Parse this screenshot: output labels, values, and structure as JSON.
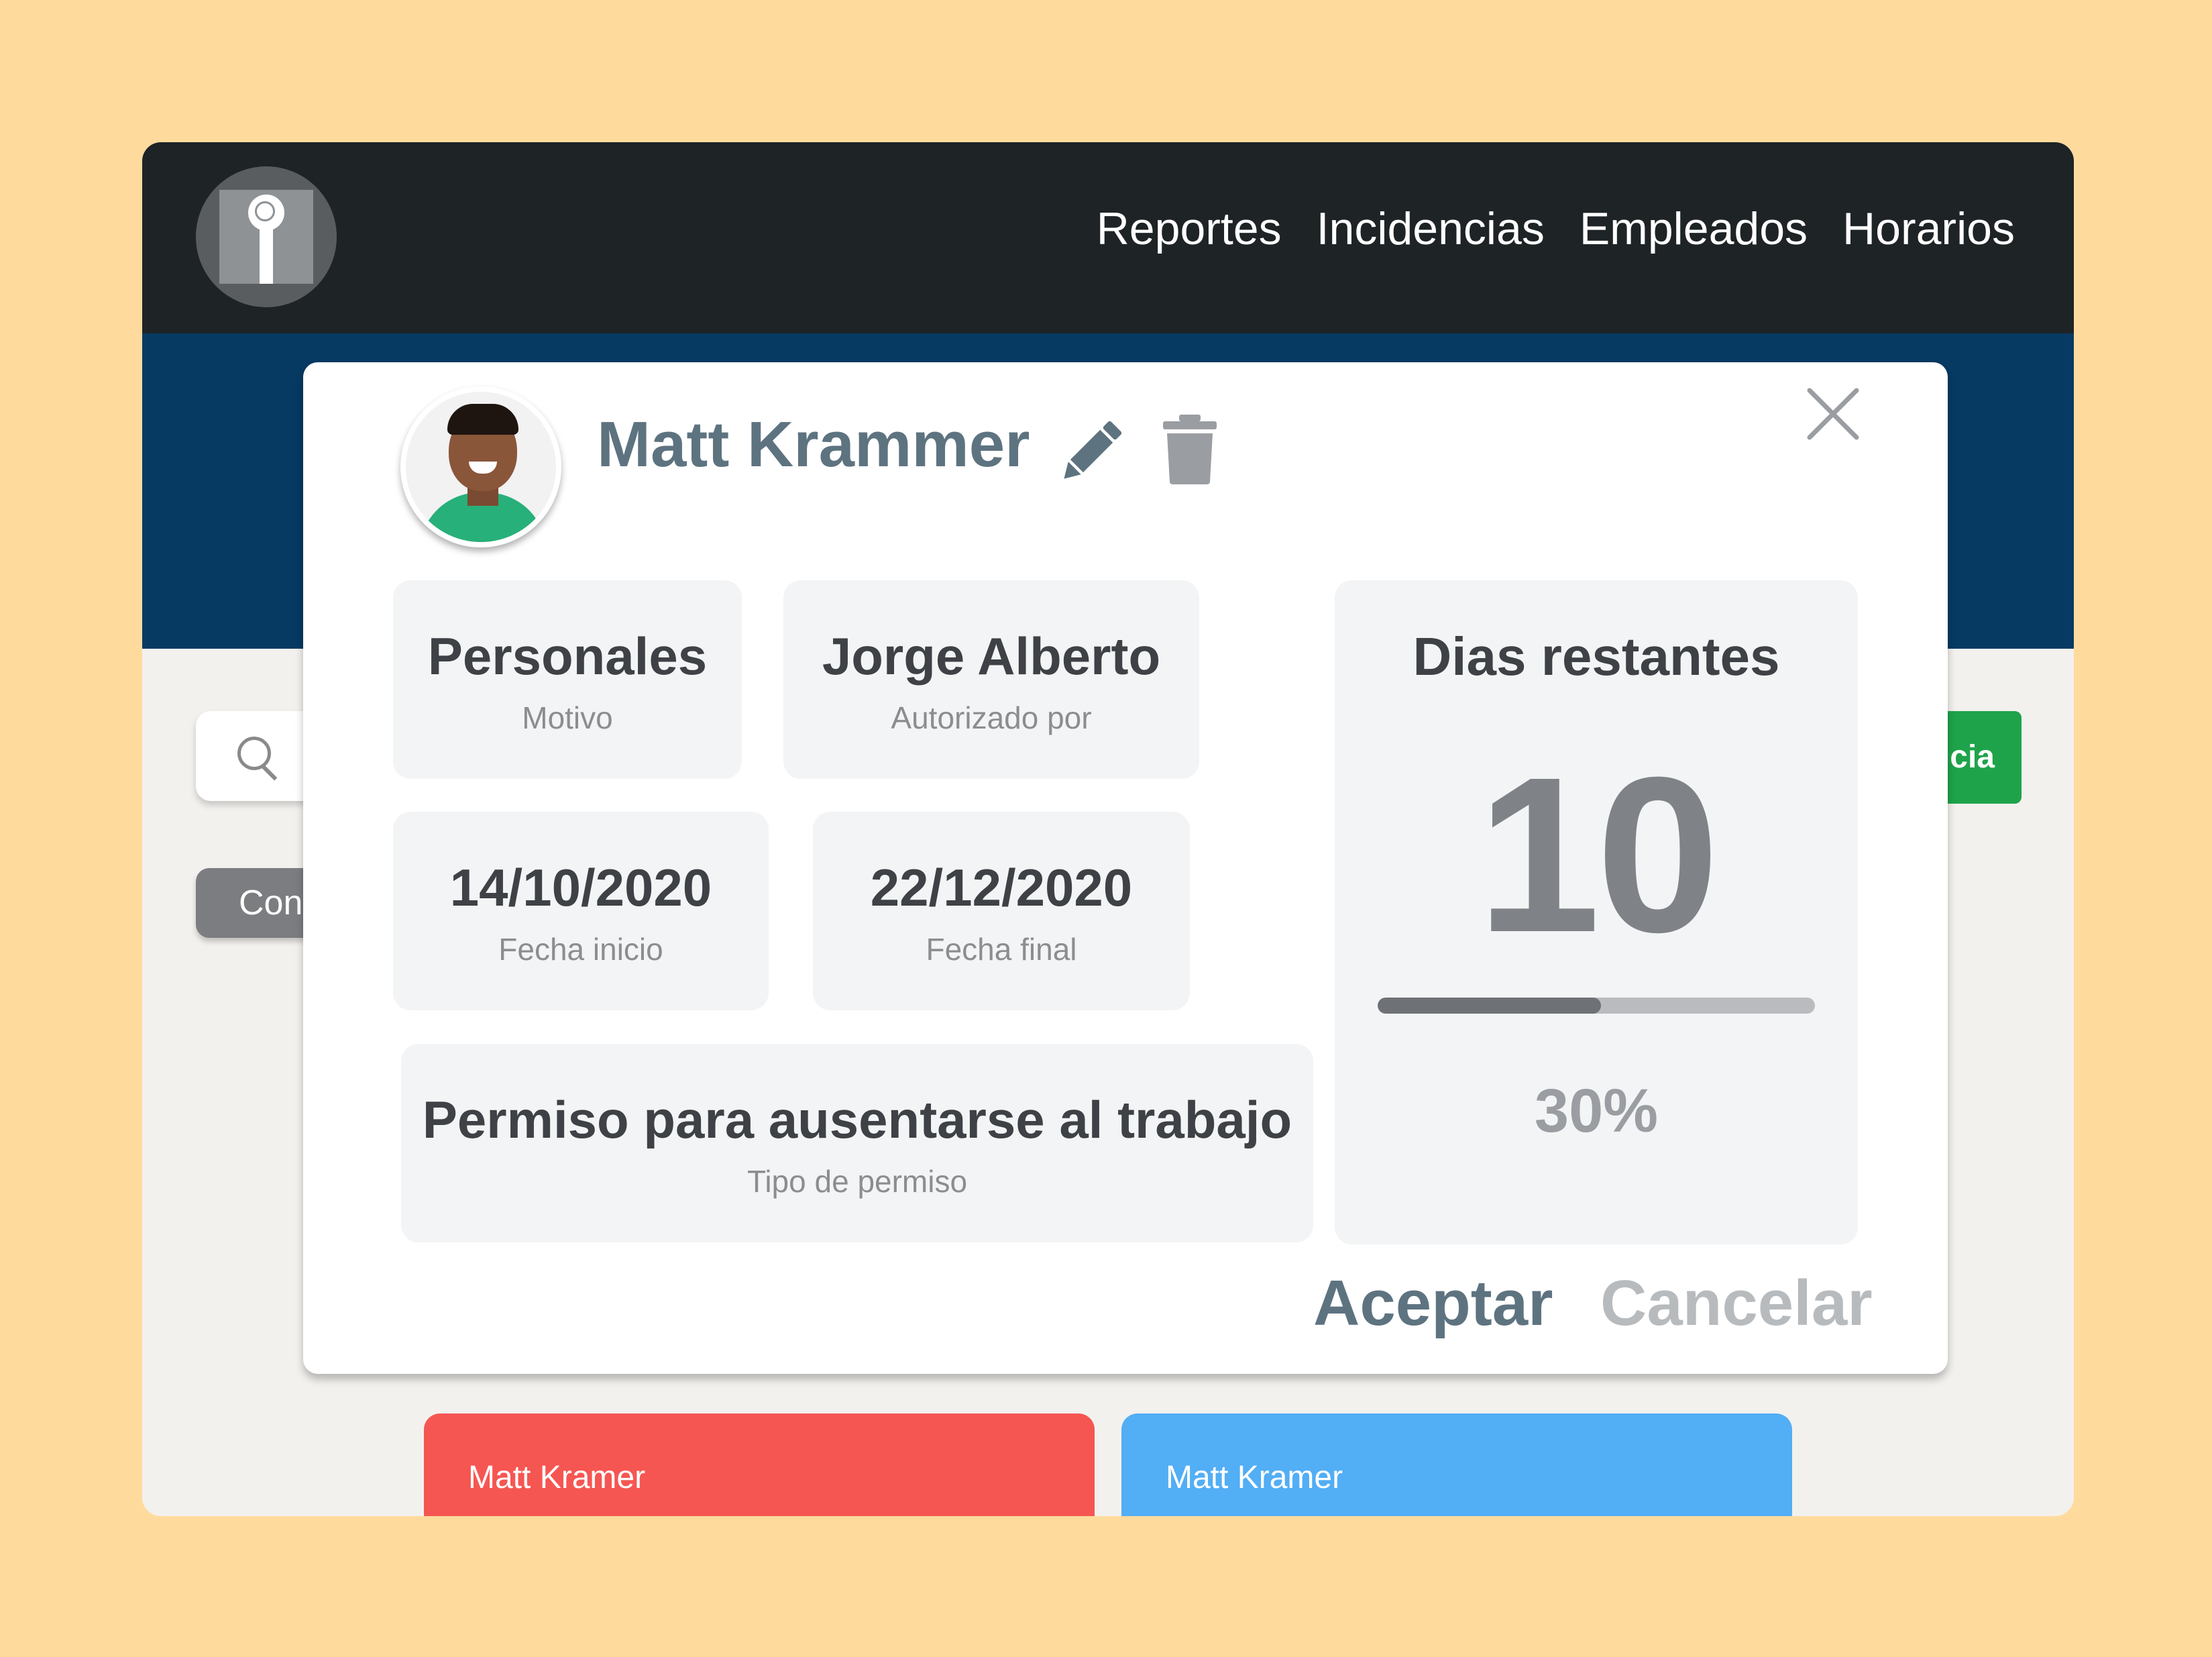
{
  "nav": {
    "items": [
      "Reportes",
      "Incidencias",
      "Empleados",
      "Horarios"
    ]
  },
  "background": {
    "con_button": "Con",
    "green_button": "cia",
    "cards": [
      "Matt Kramer",
      "Matt Kramer"
    ]
  },
  "modal": {
    "name": "Matt Krammer",
    "tiles": {
      "motivo": {
        "value": "Personales",
        "label": "Motivo"
      },
      "autorizado": {
        "value": "Jorge Alberto",
        "label": "Autorizado por"
      },
      "inicio": {
        "value": "14/10/2020",
        "label": "Fecha inicio"
      },
      "final": {
        "value": "22/12/2020",
        "label": "Fecha final"
      },
      "tipo": {
        "value": "Permiso para ausentarse al trabajo",
        "label": "Tipo de permiso"
      }
    },
    "days": {
      "title": "Dias restantes",
      "number": "10",
      "percent_label": "30%",
      "progress_fraction": 0.51
    },
    "actions": {
      "accept": "Aceptar",
      "cancel": "Cancelar"
    }
  },
  "colors": {
    "background": "#FEDB9D",
    "topbar": "#1E2326",
    "header_band": "#063A63",
    "accent_text": "#5E7380",
    "green": "#1FA34A",
    "red": "#F65652",
    "blue": "#52AEF5"
  },
  "icons": [
    "fingerprint-logo-icon",
    "search-icon",
    "pencil-icon",
    "trash-icon",
    "close-icon"
  ]
}
